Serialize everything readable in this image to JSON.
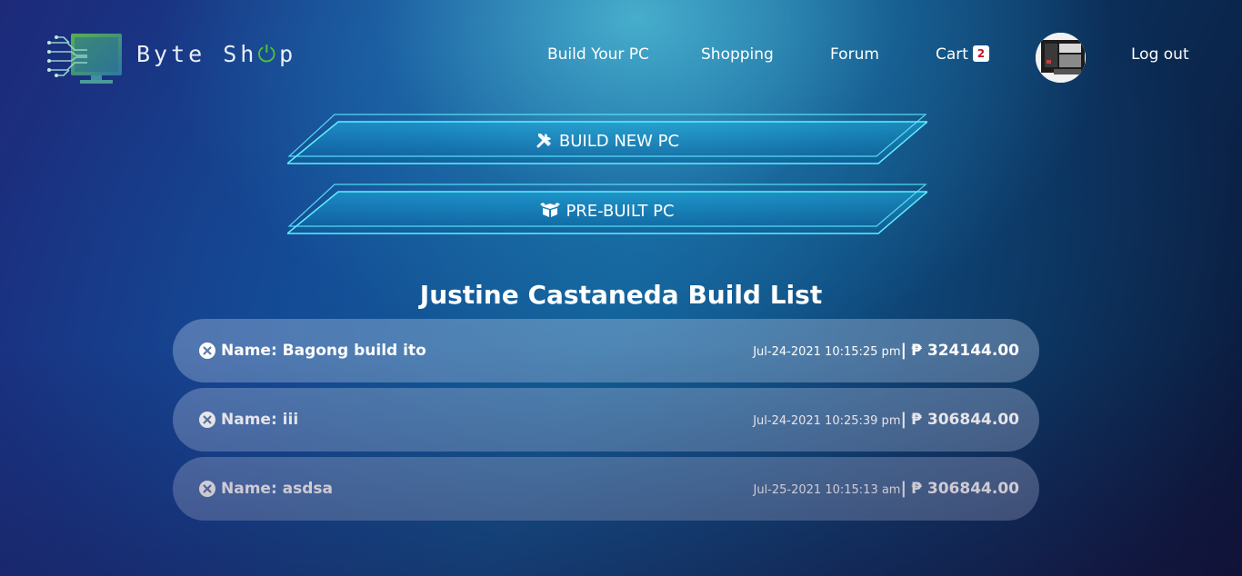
{
  "header": {
    "brand": "Byte Sh",
    "brand_power_glyph": "⏻",
    "brand_tail": "p",
    "nav": {
      "build": "Build Your PC",
      "shopping": "Shopping",
      "forum": "Forum",
      "cart": "Cart",
      "cart_count": "2",
      "logout": "Log out"
    }
  },
  "actions": {
    "build_new": "BUILD NEW PC",
    "pre_built": "PRE-BUILT PC"
  },
  "list": {
    "title": "Justine Castaneda Build List",
    "rows": [
      {
        "name": "Name: Bagong build ito",
        "date": "Jul-24-2021 10:15:25 pm",
        "price": "₱ 324144.00"
      },
      {
        "name": "Name: iii",
        "date": "Jul-24-2021 10:25:39 pm",
        "price": "₱ 306844.00"
      },
      {
        "name": "Name: asdsa",
        "date": "Jul-25-2021 10:15:13 am",
        "price": "₱ 306844.00"
      }
    ],
    "separator": "|"
  },
  "colors": {
    "accent_cyan": "#3ee6ff",
    "brand_green": "#4fbf3a",
    "badge_red": "#c1121f"
  },
  "icons": [
    "logo-monitor-circuit-icon",
    "tools-icon",
    "box-open-icon",
    "times-circle-icon",
    "avatar-image"
  ]
}
